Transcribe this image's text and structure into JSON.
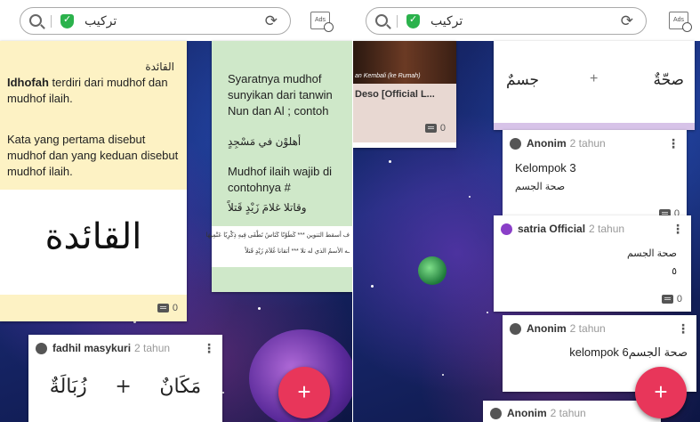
{
  "browser": {
    "url_text": "تركيب",
    "ads_label": "Ads"
  },
  "left": {
    "yellow_card": {
      "heading": "القائدة",
      "bold_term": "Idhofah",
      "para1_rest": " terdiri dari mudhof dan mudhof ilaih.",
      "para2": "Kata yang pertama disebut mudhof dan yang keduan disebut mudhof ilaih.",
      "big_arabic": "القائدة",
      "comment_count": "0"
    },
    "green_card": {
      "line1": "Syaratnya mudhof sunyikan dari tanwin Nun dan Al ; contoh",
      "arabic1": "أهلوْن في مَسْجِدٍ",
      "line2": "Mudhof ilaih wajib di contohnya #",
      "arabic2": "وقاتلا غلامَ زَيْدٍ قَتلاً",
      "img_line1": "ف أسقط التنوين *** كَطَوْنًا كَنَاسُ تَطْفَى فِيهِ ذِكْرِيًا عَنْمِيهَا",
      "img_line2": "ـه الأسمُ الذي له تلا *** أتقانا غُلاَمَ زَيْدٍ قَتلاً"
    },
    "post": {
      "author": "fadhil masykuri",
      "age": "2 tahun",
      "arabic_a": "مَكَانٌ",
      "plus": "+",
      "arabic_b": "زُبَالَةٌ"
    },
    "fab_label": "+"
  },
  "right": {
    "video_card": {
      "caption_small": "an Kembali (ke Rumah)",
      "title": "Deso [Official L...",
      "comment_count": "0"
    },
    "top_card": {
      "arabic_right": "صحّةٌ",
      "plus": "+",
      "arabic_left": "جسمٌ"
    },
    "post1": {
      "author": "Anonim",
      "age": "2 tahun",
      "title": "Kelompok 3",
      "arabic": "صحة الجسم",
      "comment_count": "0"
    },
    "post2": {
      "author": "satria Official",
      "age": "2 tahun",
      "arabic": "صحة الجسم",
      "number": "٥",
      "comment_count": "0"
    },
    "post3": {
      "author": "Anonim",
      "age": "2 tahun",
      "text": "kelompok 6صحة الجسم"
    },
    "post4": {
      "author": "Anonim",
      "age": "2 tahun"
    },
    "fab_label": "+"
  }
}
